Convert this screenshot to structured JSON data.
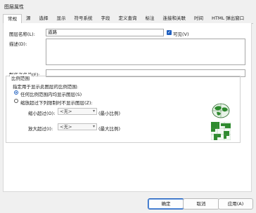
{
  "window": {
    "title": "图层属性"
  },
  "tabs": [
    {
      "label": "常规",
      "active": true
    },
    {
      "label": "源"
    },
    {
      "label": "选择"
    },
    {
      "label": "显示"
    },
    {
      "label": "符号系统"
    },
    {
      "label": "字段"
    },
    {
      "label": "定义查询"
    },
    {
      "label": "标注"
    },
    {
      "label": "连接和关联"
    },
    {
      "label": "时间"
    },
    {
      "label": "HTML 弹出窗口"
    }
  ],
  "general": {
    "layer_name_label": "图层名称(L):",
    "layer_name_value": "道路",
    "visible_label": "可见(V)",
    "visible_checked": true,
    "description_label": "描述(D):",
    "credits_label": "制作者名单(E):",
    "credits_value": ""
  },
  "scale_range": {
    "group_title": "比例范围",
    "instruction": "指定用于显示此图层的比例范围:",
    "option_any": "任何比例范围内均显示图层(S)",
    "option_range": "缩放超过下列限制时不显示图层(Z):",
    "selected_option": "any",
    "min_label": "缩小超过(O):",
    "min_value": "<无>",
    "min_hint": "(最小比例)",
    "max_label": "放大超过(I):",
    "max_value": "<无>",
    "max_hint": "(最大比例)"
  },
  "buttons": {
    "ok": "确定",
    "cancel": "取消",
    "apply": "应用(A)"
  },
  "colors": {
    "accent": "#1f5fbf",
    "globe_green": "#3a8a3a"
  }
}
